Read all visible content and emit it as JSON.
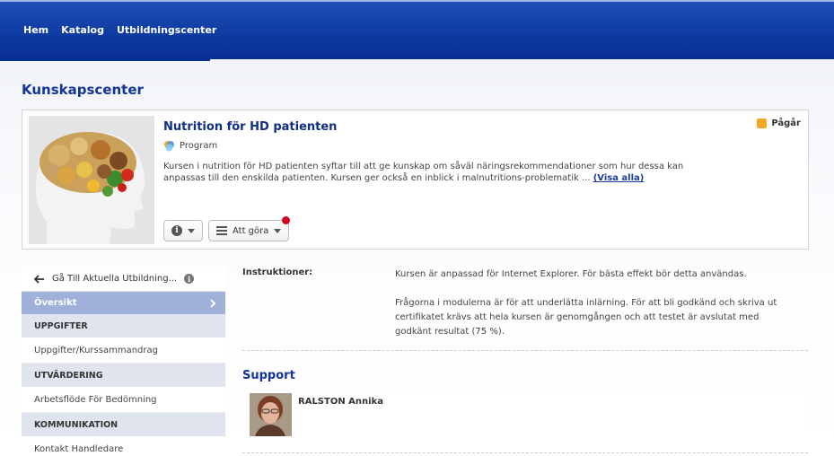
{
  "nav": {
    "items": [
      "Hem",
      "Katalog",
      "Utbildningscenter"
    ]
  },
  "page": {
    "title": "Kunskapscenter"
  },
  "course": {
    "title": "Nutrition för HD patienten",
    "type": "Program",
    "description": "Kursen i nutrition för HD patienten syftar till att ge kunskap om såväl näringsrekommendationer som hur dessa kan anpassas till den enskilda patienten. Kursen ger också en inblick i malnutritions-problematik ...",
    "show_all": "(Visa alla)",
    "status": "Pågår",
    "status_color": "#f5a623",
    "todo_label": "Att göra"
  },
  "sidebar": {
    "back_label": "Gå Till Aktuella Utbildning...",
    "active_item": "Översikt",
    "sections": [
      {
        "header": "UPPGIFTER",
        "item": "Uppgifter/Kurssammandrag"
      },
      {
        "header": "UTVÄRDERING",
        "item": "Arbetsflöde För Bedömning"
      },
      {
        "header": "KOMMUNIKATION",
        "item": "Kontakt Handledare"
      }
    ]
  },
  "instructions": {
    "label": "Instruktioner:",
    "paragraph1": "Kursen är anpassad för Internet Explorer. För bästa effekt bör detta användas.",
    "paragraph2": "Frågorna i modulerna är för att underlätta inlärning. För att bli godkänd och skriva ut certifikatet krävs att hela kursen är genomgången och att testet är avslutat med godkänt resultat (75 %)."
  },
  "support": {
    "title": "Support",
    "name": "RALSTON Annika"
  }
}
